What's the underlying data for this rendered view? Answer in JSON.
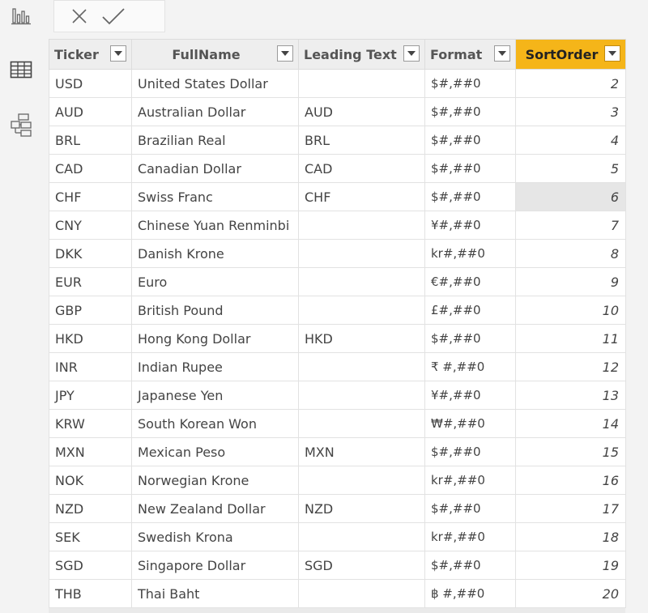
{
  "sidebar": {
    "icons": [
      "report-view-icon",
      "data-view-icon",
      "model-view-icon"
    ]
  },
  "formula_bar": {
    "cancel_icon": "close-icon",
    "commit_icon": "check-icon"
  },
  "table": {
    "columns": [
      {
        "label": "Ticker",
        "active": false
      },
      {
        "label": "FullName",
        "active": false
      },
      {
        "label": "Leading Text",
        "active": false
      },
      {
        "label": "Format",
        "active": false
      },
      {
        "label": "SortOrder",
        "active": true
      }
    ],
    "rows": [
      {
        "ticker": "USD",
        "full_name": "United States Dollar",
        "leading_text": "",
        "format": "$#,##0",
        "sort_order": "2"
      },
      {
        "ticker": "AUD",
        "full_name": "Australian Dollar",
        "leading_text": "AUD",
        "format": "$#,##0",
        "sort_order": "3"
      },
      {
        "ticker": "BRL",
        "full_name": "Brazilian Real",
        "leading_text": "BRL",
        "format": "$#,##0",
        "sort_order": "4"
      },
      {
        "ticker": "CAD",
        "full_name": "Canadian Dollar",
        "leading_text": "CAD",
        "format": "$#,##0",
        "sort_order": "5"
      },
      {
        "ticker": "CHF",
        "full_name": "Swiss Franc",
        "leading_text": "CHF",
        "format": "$#,##0",
        "sort_order": "6"
      },
      {
        "ticker": "CNY",
        "full_name": "Chinese Yuan Renminbi",
        "leading_text": "",
        "format": "¥#,##0",
        "sort_order": "7"
      },
      {
        "ticker": "DKK",
        "full_name": "Danish Krone",
        "leading_text": "",
        "format": "kr#,##0",
        "sort_order": "8"
      },
      {
        "ticker": "EUR",
        "full_name": "Euro",
        "leading_text": "",
        "format": "€#,##0",
        "sort_order": "9"
      },
      {
        "ticker": "GBP",
        "full_name": "British Pound",
        "leading_text": "",
        "format": "£#,##0",
        "sort_order": "10"
      },
      {
        "ticker": "HKD",
        "full_name": "Hong Kong Dollar",
        "leading_text": "HKD",
        "format": "$#,##0",
        "sort_order": "11"
      },
      {
        "ticker": "INR",
        "full_name": "Indian Rupee",
        "leading_text": "",
        "format": "₹ #,##0",
        "sort_order": "12"
      },
      {
        "ticker": "JPY",
        "full_name": "Japanese Yen",
        "leading_text": "",
        "format": "¥#,##0",
        "sort_order": "13"
      },
      {
        "ticker": "KRW",
        "full_name": "South Korean Won",
        "leading_text": "",
        "format": "₩#,##0",
        "sort_order": "14"
      },
      {
        "ticker": "MXN",
        "full_name": "Mexican Peso",
        "leading_text": "MXN",
        "format": "$#,##0",
        "sort_order": "15"
      },
      {
        "ticker": "NOK",
        "full_name": "Norwegian Krone",
        "leading_text": "",
        "format": "kr#,##0",
        "sort_order": "16"
      },
      {
        "ticker": "NZD",
        "full_name": "New Zealand Dollar",
        "leading_text": "NZD",
        "format": "$#,##0",
        "sort_order": "17"
      },
      {
        "ticker": "SEK",
        "full_name": "Swedish Krona",
        "leading_text": "",
        "format": "kr#,##0",
        "sort_order": "18"
      },
      {
        "ticker": "SGD",
        "full_name": "Singapore Dollar",
        "leading_text": "SGD",
        "format": "$#,##0",
        "sort_order": "19"
      },
      {
        "ticker": "THB",
        "full_name": "Thai Baht",
        "leading_text": "",
        "format": "฿ #,##0",
        "sort_order": "20"
      }
    ],
    "selected_cell": {
      "row": 4,
      "column": "sort_order"
    }
  },
  "colors": {
    "active_header": "#f5b519",
    "selected_cell": "#e6e6e6"
  }
}
